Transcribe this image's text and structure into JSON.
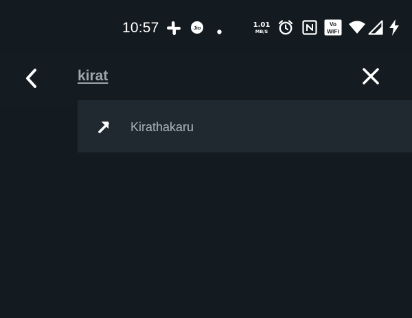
{
  "status_bar": {
    "time": "10:57",
    "net_speed_value": "1.01",
    "net_speed_unit": "MB/S",
    "icons": [
      "slack-icon",
      "jio-icon",
      "dot-icon",
      "alarm-icon",
      "nfc-icon",
      "vowifi-icon",
      "wifi-icon",
      "cell-signal-icon",
      "charging-icon"
    ],
    "jio_label": "Jio",
    "vowifi_top": "Vo",
    "vowifi_bottom": "WiFi"
  },
  "header": {
    "search_query": "kirat"
  },
  "suggestions": [
    {
      "label": "Kirathakaru",
      "icon": "arrow-up-right-icon"
    }
  ],
  "colors": {
    "background": "#141b20",
    "suggestion_bg": "#1f292f",
    "query_text": "#9ea7ae",
    "suggestion_text": "#a9b3ba"
  }
}
